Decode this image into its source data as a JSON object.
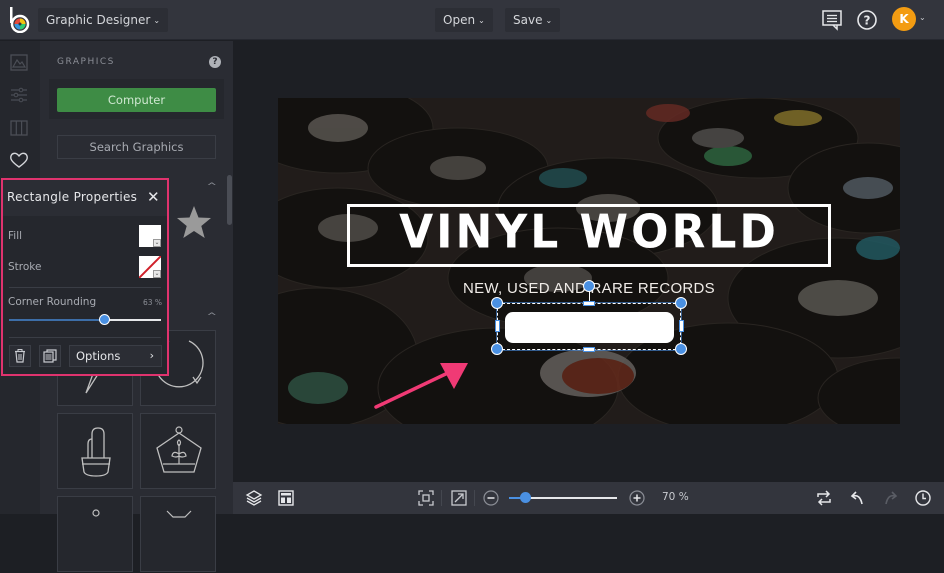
{
  "topbar": {
    "app_menu_label": "Graphic Designer",
    "open_label": "Open",
    "save_label": "Save",
    "avatar_initial": "K",
    "icons": [
      "comments-icon",
      "help-icon",
      "user-avatar"
    ]
  },
  "rail": {
    "items": [
      "background-icon",
      "adjust-icon",
      "frames-icon",
      "graphics-heart-icon"
    ]
  },
  "graphics_panel": {
    "title": "GRAPHICS",
    "help": "?",
    "computer_label": "Computer",
    "search_label": "Search Graphics"
  },
  "rectangle_properties": {
    "title": "Rectangle Properties",
    "close": "✕",
    "fill_label": "Fill",
    "fill_color": "#ffffff",
    "stroke_label": "Stroke",
    "stroke_color": "none",
    "corner_rounding_label": "Corner Rounding",
    "corner_rounding_value": "63 %",
    "corner_rounding_fraction": 0.63,
    "options_label": "Options",
    "options_chevron": "›"
  },
  "design": {
    "title": "VINYL WORLD",
    "subtitle": "NEW, USED AND RARE RECORDS",
    "accent_annotation_color": "#f03a75",
    "selection_color": "#4a90e2"
  },
  "bottombar": {
    "zoom_level": "70 %",
    "zoom_fraction": 0.15,
    "icons": [
      "layers-icon",
      "layout-icon",
      "fit-screen-icon",
      "fullscreen-icon",
      "zoom-out-icon",
      "zoom-in-icon",
      "flip-icon",
      "undo-icon",
      "redo-icon",
      "history-icon"
    ]
  }
}
